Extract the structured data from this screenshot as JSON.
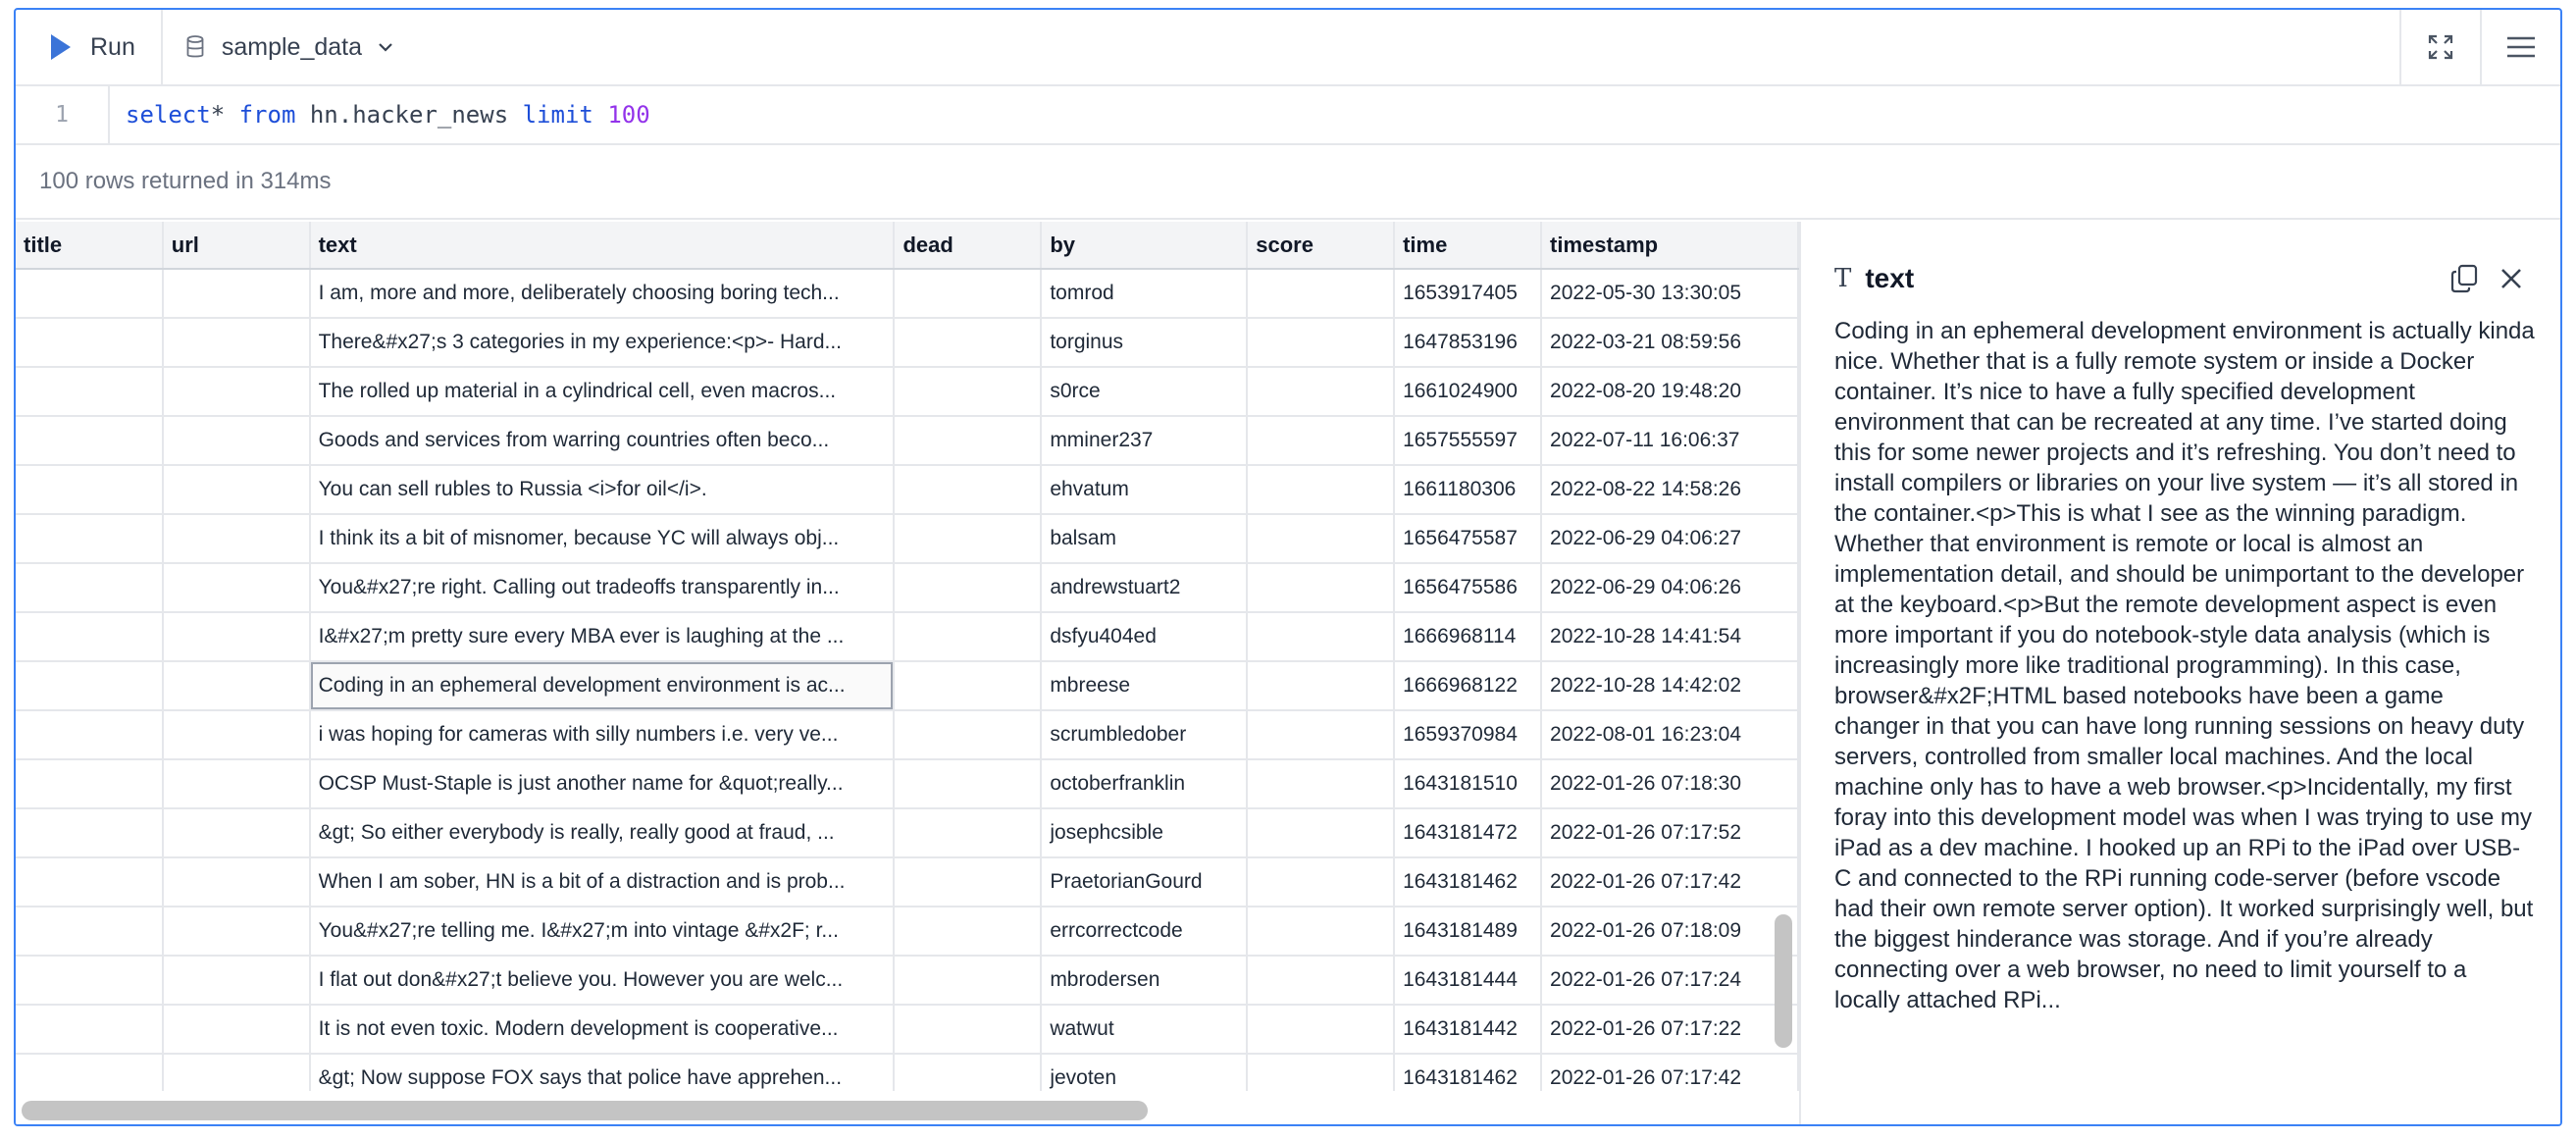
{
  "toolbar": {
    "run_label": "Run",
    "database_label": "sample_data",
    "icons": [
      "play-icon",
      "database-icon",
      "chevron-down-icon",
      "expand-icon",
      "menu-icon"
    ]
  },
  "editor": {
    "line_number": "1",
    "tokens": {
      "select": "select",
      "star": "*",
      "from": "from",
      "table": "hn.hacker_news",
      "limit": "limit",
      "limit_value": "100"
    }
  },
  "status": "100 rows returned in 314ms",
  "grid": {
    "columns": [
      "title",
      "url",
      "text",
      "dead",
      "by",
      "score",
      "time",
      "timestamp"
    ],
    "rows": [
      [
        "",
        "",
        "I am, more and more, deliberately choosing boring tech...",
        "",
        "tomrod",
        "",
        "1653917405",
        "2022-05-30 13:30:05"
      ],
      [
        "",
        "",
        "There&#x27;s 3 categories in my experience:<p>- Hard...",
        "",
        "torginus",
        "",
        "1647853196",
        "2022-03-21 08:59:56"
      ],
      [
        "",
        "",
        "The rolled up material in a cylindrical cell, even macros...",
        "",
        "s0rce",
        "",
        "1661024900",
        "2022-08-20 19:48:20"
      ],
      [
        "",
        "",
        "Goods and services from warring countries often beco...",
        "",
        "mminer237",
        "",
        "1657555597",
        "2022-07-11 16:06:37"
      ],
      [
        "",
        "",
        "You can sell rubles to Russia <i>for oil</i>.",
        "",
        "ehvatum",
        "",
        "1661180306",
        "2022-08-22 14:58:26"
      ],
      [
        "",
        "",
        "I think its a bit of misnomer, because YC will always obj...",
        "",
        "balsam",
        "",
        "1656475587",
        "2022-06-29 04:06:27"
      ],
      [
        "",
        "",
        "You&#x27;re right. Calling out tradeoffs transparently in...",
        "",
        "andrewstuart2",
        "",
        "1656475586",
        "2022-06-29 04:06:26"
      ],
      [
        "",
        "",
        "I&#x27;m pretty sure every MBA ever is laughing at the ...",
        "",
        "dsfyu404ed",
        "",
        "1666968114",
        "2022-10-28 14:41:54"
      ],
      [
        "",
        "",
        "Coding in an ephemeral development environment is ac...",
        "",
        "mbreese",
        "",
        "1666968122",
        "2022-10-28 14:42:02"
      ],
      [
        "",
        "",
        "i was hoping for cameras with silly numbers i.e. very ve...",
        "",
        "scrumbledober",
        "",
        "1659370984",
        "2022-08-01 16:23:04"
      ],
      [
        "",
        "",
        "OCSP Must-Staple is just another name for &quot;really...",
        "",
        "octoberfranklin",
        "",
        "1643181510",
        "2022-01-26 07:18:30"
      ],
      [
        "",
        "",
        "&gt; So either everybody is really, really good at fraud, ...",
        "",
        "josephcsible",
        "",
        "1643181472",
        "2022-01-26 07:17:52"
      ],
      [
        "",
        "",
        "When I am sober, HN is a bit of a distraction and is prob...",
        "",
        "PraetorianGourd",
        "",
        "1643181462",
        "2022-01-26 07:17:42"
      ],
      [
        "",
        "",
        "You&#x27;re telling me. I&#x27;m into vintage &#x2F; r...",
        "",
        "errcorrectcode",
        "",
        "1643181489",
        "2022-01-26 07:18:09"
      ],
      [
        "",
        "",
        "I flat out don&#x27;t believe you. However you are welc...",
        "",
        "mbrodersen",
        "",
        "1643181444",
        "2022-01-26 07:17:24"
      ],
      [
        "",
        "",
        "It is not even toxic. Modern development is cooperative...",
        "",
        "watwut",
        "",
        "1643181442",
        "2022-01-26 07:17:22"
      ],
      [
        "",
        "",
        "&gt; Now suppose FOX says that police have apprehen...",
        "",
        "jevoten",
        "",
        "1643181462",
        "2022-01-26 07:17:42"
      ]
    ],
    "selected_row": 8,
    "selected_column": 2
  },
  "panel": {
    "type_icon": "T",
    "title": "text",
    "icons": [
      "text-type-icon",
      "copy-icon",
      "close-icon"
    ],
    "body": "Coding in an ephemeral development environment is actually kinda nice. Whether that is a fully remote system or inside a Docker container. It’s nice to have a fully specified development environment that can be recreated at any time. I’ve started doing this for some newer projects and it’s refreshing. You don’t need to install compilers or libraries on your live system — it’s all stored in the container.<p>This is what I see as the winning paradigm. Whether that environment is remote or local is almost an implementation detail, and should be unimportant to the developer at the keyboard.<p>But the remote development aspect is even more important if you do notebook-style data analysis (which is increasingly more like traditional programming). In this case, browser&#x2F;HTML based notebooks have been a game changer in that you can have long running sessions on heavy duty servers, controlled from smaller local machines. And the local machine only has to have a web browser.<p>Incidentally, my first foray into this development model was when I was trying to use my iPad as a dev machine. I hooked up an RPi to the iPad over USB-C and connected to the RPi running code-server (before vscode had their own remote server option). It worked surprisingly well, but the biggest hinderance was storage. And if you’re already connecting over a web browser, no need to limit yourself to a locally attached RPi..."
  }
}
